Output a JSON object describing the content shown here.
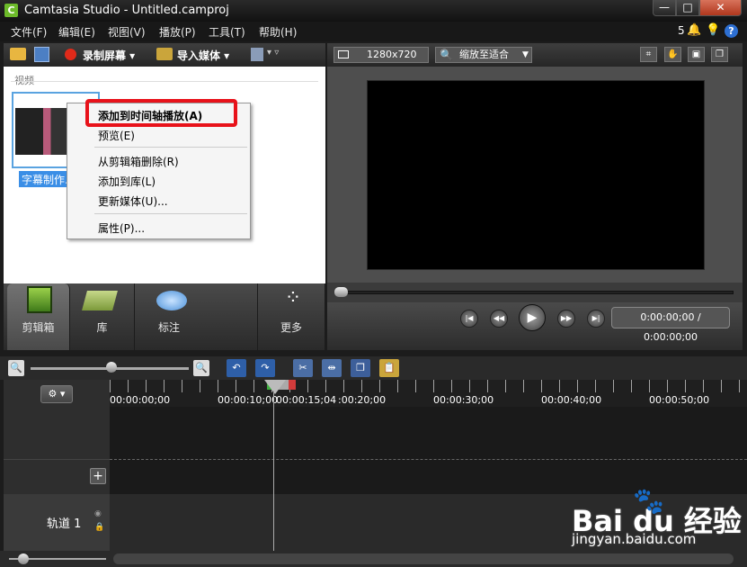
{
  "window": {
    "app_icon": "C",
    "title": "Camtasia Studio - Untitled.camproj",
    "min": "—",
    "max": "□",
    "close": "✕"
  },
  "menubar": {
    "items": [
      "文件(F)",
      "编辑(E)",
      "视图(V)",
      "播放(P)",
      "工具(T)",
      "帮助(H)"
    ],
    "notification_count": "5"
  },
  "toolbar": {
    "record_label": "录制屏幕 ▾",
    "import_label": "导入媒体 ▾",
    "produce_caret": "▾ ▿"
  },
  "clip_bin": {
    "header": "视频",
    "clip_name": "字幕制作."
  },
  "context_menu": {
    "items": [
      "添加到时间轴播放(A)",
      "预览(E)",
      "从剪辑箱删除(R)",
      "添加到库(L)",
      "更新媒体(U)...",
      "属性(P)..."
    ]
  },
  "tabs": [
    {
      "label": "剪辑箱"
    },
    {
      "label": "库"
    },
    {
      "label": "标注"
    },
    {
      "label": "更多"
    }
  ],
  "preview": {
    "resolution": "1280x720",
    "zoom": "缩放至适合",
    "time": "0:00:00;00 / 0:00:00;00"
  },
  "timeline": {
    "ticks": [
      "00:00:00;00",
      "00:00:10;00",
      "00:00:15;04",
      ":00:20;00",
      "00:00:30;00",
      "00:00:40;00",
      "00:00:50;00"
    ],
    "track_label": "轨道 1"
  },
  "watermark": {
    "logo": "Bai  du 经验",
    "url": "jingyan.baidu.com"
  },
  "colors": {
    "highlight": "#e8121a",
    "selection": "#3a8ee6",
    "record": "#e02a1a"
  }
}
